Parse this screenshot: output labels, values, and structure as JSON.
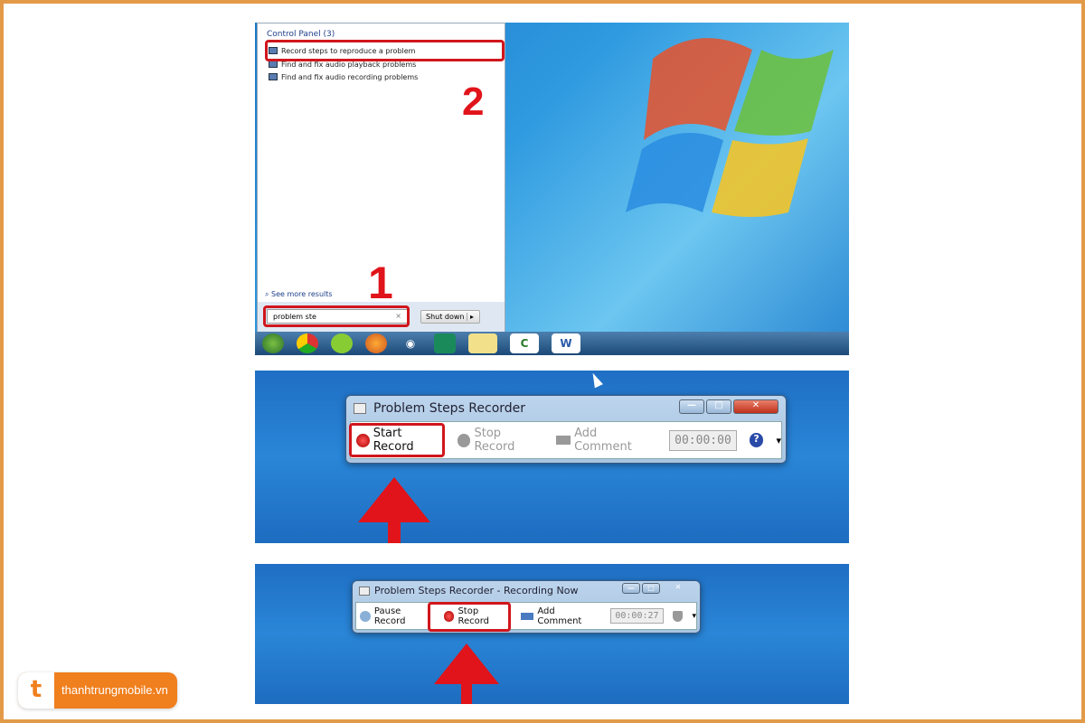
{
  "step1": {
    "section_header": "Control Panel (3)",
    "results": [
      "Record steps to reproduce a problem",
      "Find and fix audio playback problems",
      "Find and fix audio recording problems"
    ],
    "see_more": "See more results",
    "search_value": "problem ste",
    "clear": "×",
    "shutdown": "Shut down",
    "shutdown_arrow": "▸",
    "label_1": "1",
    "label_2": "2",
    "taskbar_icons": [
      "start-orb",
      "chrome",
      "coccoc",
      "firefox",
      "weibo",
      "app-green",
      "notepad",
      "camtasia",
      "word"
    ]
  },
  "step2": {
    "title": "Problem Steps Recorder",
    "start": "Start Record",
    "stop": "Stop Record",
    "comment": "Add Comment",
    "timer": "00:00:00",
    "help": "?",
    "dropdown": "▾",
    "minimize": "—",
    "maximize": "□",
    "close": "✕"
  },
  "step3": {
    "title": "Problem Steps Recorder - Recording Now",
    "pause": "Pause Record",
    "stop": "Stop Record",
    "comment": "Add Comment",
    "timer": "00:00:27",
    "dropdown": "▾",
    "minimize": "—",
    "maximize": "□",
    "close": "✕"
  },
  "brand": {
    "name": "thanhtrungmobile.vn",
    "color": "#f07f1e"
  },
  "colors": {
    "highlight": "#d0161c",
    "border": "#e29a48"
  }
}
